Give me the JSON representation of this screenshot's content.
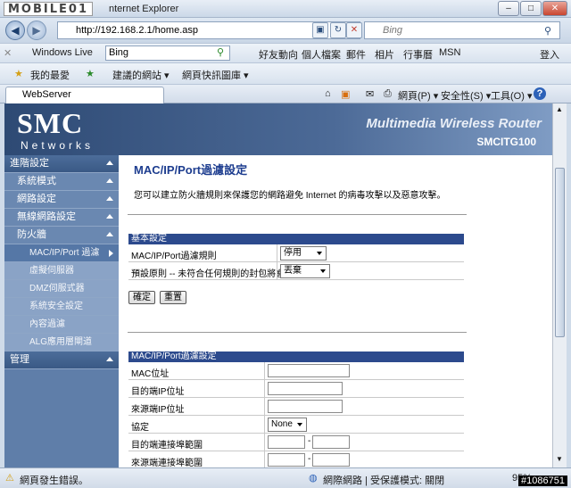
{
  "window": {
    "logo_text": "MOBILE01",
    "title": "nternet Explorer",
    "min": "–",
    "max": "□",
    "close": "✕"
  },
  "address": {
    "url": "http://192.168.2.1/home.asp",
    "search_placeholder": "Bing"
  },
  "windows_live": {
    "label": "Windows Live",
    "search_value": "Bing",
    "links": [
      "好友動向",
      "個人檔案",
      "郵件",
      "相片",
      "行事曆",
      "MSN"
    ],
    "signin": "登入"
  },
  "favorites": {
    "favorites_label": "我的最愛",
    "suggested_sites": "建議的網站 ▾",
    "web_slice": "網頁快訊圖庫 ▾"
  },
  "tab": {
    "label": "WebServer"
  },
  "command_bar": {
    "page": "網頁(P) ▾",
    "safety": "安全性(S) ▾",
    "tools": "工具(O) ▾",
    "help": "?"
  },
  "banner": {
    "brand": "SMC",
    "brand_sub": "Networks",
    "product": "Multimedia Wireless Router",
    "model": "SMCITG100"
  },
  "sidebar": {
    "advanced": "進階設定",
    "items": [
      "系統模式",
      "網路設定",
      "無線網路設定",
      "防火牆"
    ],
    "firewall_items": [
      "MAC/IP/Port 過濾",
      "虛擬伺服器",
      "DMZ伺服式器",
      "系統安全設定",
      "內容過濾",
      "ALG應用層閘道"
    ],
    "manage": "管理"
  },
  "page": {
    "title": "MAC/IP/Port過濾設定",
    "description": "您可以建立防火牆規則來保護您的網路避免 Internet 的病毒攻擊以及惡意攻擊。",
    "basic": {
      "header": "基本設定",
      "filter_label": "MAC/IP/Port過濾規則",
      "filter_value": "停用",
      "default_label": "預設原則 -- 未符合任何規則的封包將會被：",
      "default_value": "丟棄",
      "apply": "確定",
      "reset": "重置"
    },
    "rules": {
      "header": "MAC/IP/Port過濾設定",
      "mac": "MAC位址",
      "dest_ip": "目的端IP位址",
      "src_ip": "來源端IP位址",
      "protocol": "協定",
      "protocol_value": "None",
      "dest_port": "目的端連接埠範圍",
      "src_port": "來源端連接埠範圍",
      "dash": "-"
    }
  },
  "status": {
    "left": "網頁發生錯誤。",
    "zone": "網際網路 | 受保護模式: 關閉",
    "zoom": "95%",
    "watermark": "#1086751"
  }
}
